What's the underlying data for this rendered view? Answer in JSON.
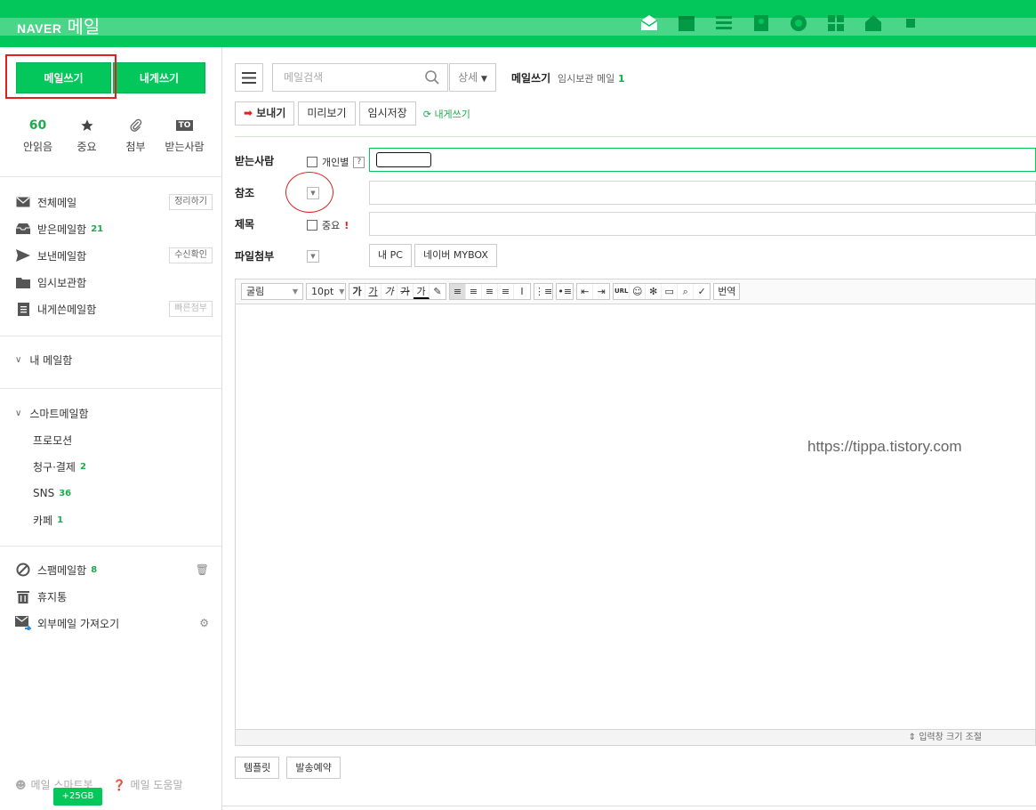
{
  "header": {
    "brand": "NAVER",
    "app": "메일"
  },
  "sidebar": {
    "write_button": "메일쓰기",
    "self_write_button": "내게쓰기",
    "quick": [
      {
        "value": "60",
        "label": "안읽음"
      },
      {
        "icon": "star-icon",
        "label": "중요"
      },
      {
        "icon": "paperclip-icon",
        "label": "첨부"
      },
      {
        "badge": "TO",
        "label": "받는사람"
      }
    ],
    "folders": [
      {
        "label": "전체메일",
        "button": "정리하기"
      },
      {
        "label": "받은메일함",
        "count": "21"
      },
      {
        "label": "보낸메일함",
        "button": "수신확인"
      },
      {
        "label": "임시보관함"
      },
      {
        "label": "내게쓴메일함",
        "button": "빠른첨부"
      }
    ],
    "my_mailbox": "내 메일함",
    "smart_mailbox": "스마트메일함",
    "smart_items": [
      {
        "label": "프로모션"
      },
      {
        "label": "청구·결제",
        "count": "2"
      },
      {
        "label": "SNS",
        "count": "36"
      },
      {
        "label": "카페",
        "count": "1"
      }
    ],
    "spam": {
      "label": "스팸메일함",
      "count": "8"
    },
    "trash": "휴지통",
    "external": "외부메일 가져오기",
    "smart_bot": "메일 스마트봇",
    "help": "메일 도움말",
    "storage": "+25GB"
  },
  "main": {
    "search_placeholder": "메일검색",
    "detail": "상세",
    "title": "메일쓰기",
    "draft_label": "임시보관 메일",
    "draft_count": "1",
    "send": "보내기",
    "preview": "미리보기",
    "save_draft": "임시저장",
    "self_write": "내게쓰기",
    "to_label": "받는사람",
    "individual": "개인별",
    "help_mark": "?",
    "cc_label": "참조",
    "subject_label": "제목",
    "important": "중요",
    "attach_label": "파일첨부",
    "my_pc": "내 PC",
    "mybox": "네이버 MYBOX",
    "font": "굴림",
    "size": "10pt",
    "translate": "번역",
    "resize": "⇕ 입력창 크기 조절",
    "template": "템플릿",
    "schedule": "발송예약",
    "watermark": "https://tippa.tistory.com"
  }
}
